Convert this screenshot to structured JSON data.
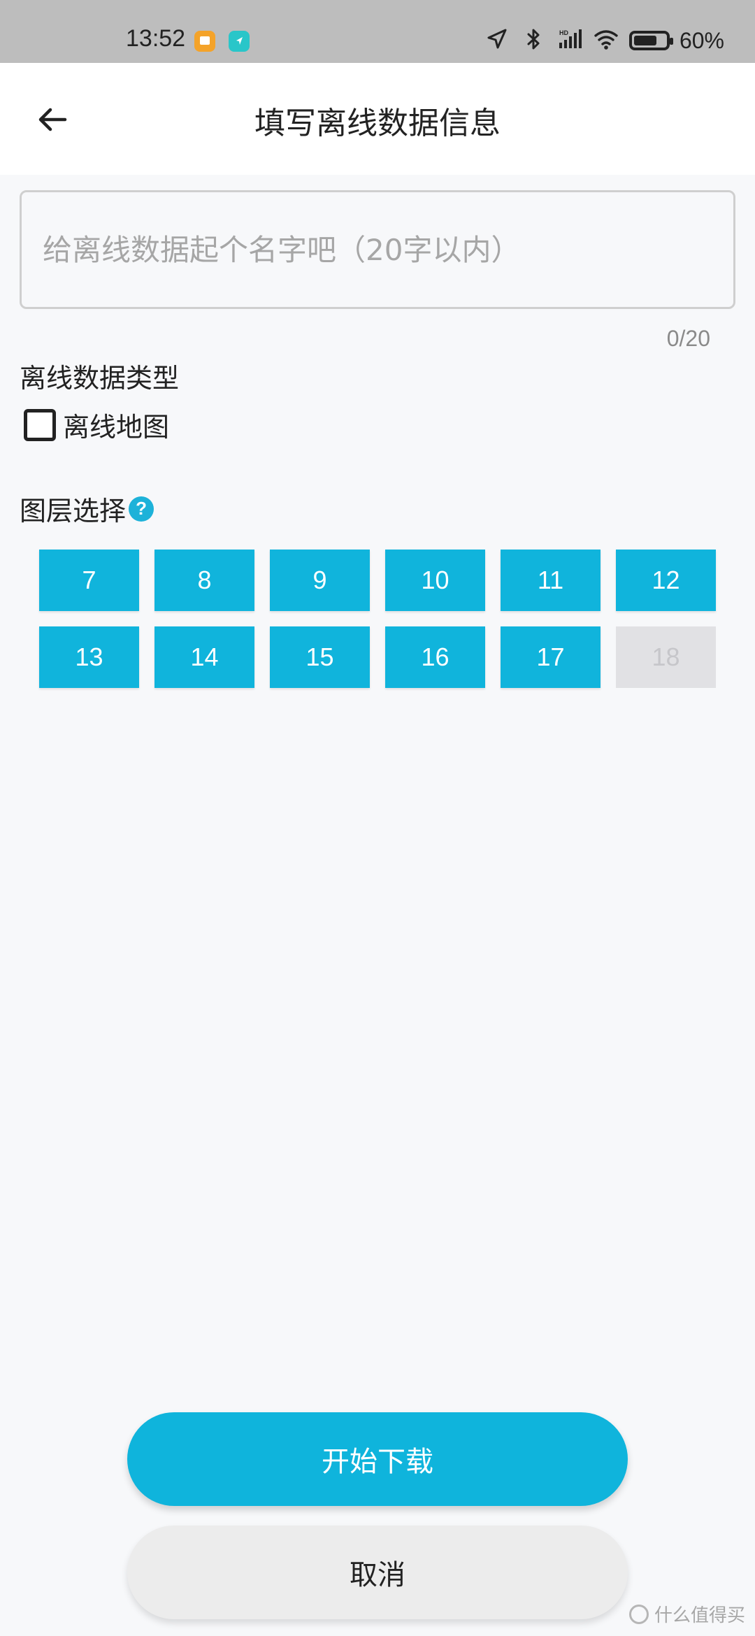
{
  "status_bar": {
    "time": "13:52",
    "battery_text": "60%",
    "icons": [
      "orange-app-icon",
      "teal-navigation-icon",
      "location-arrow-icon",
      "bluetooth-icon",
      "hd-signal-icon",
      "wifi-icon",
      "battery-icon"
    ]
  },
  "header": {
    "title": "填写离线数据信息"
  },
  "form": {
    "name_placeholder": "给离线数据起个名字吧（20字以内）",
    "name_value": "",
    "char_count": "0/20",
    "type_label": "离线数据类型",
    "offline_map_label": "离线地图",
    "layer_label": "图层选择",
    "layers": [
      {
        "label": "7",
        "enabled": true
      },
      {
        "label": "8",
        "enabled": true
      },
      {
        "label": "9",
        "enabled": true
      },
      {
        "label": "10",
        "enabled": true
      },
      {
        "label": "11",
        "enabled": true
      },
      {
        "label": "12",
        "enabled": true
      },
      {
        "label": "13",
        "enabled": true
      },
      {
        "label": "14",
        "enabled": true
      },
      {
        "label": "15",
        "enabled": true
      },
      {
        "label": "16",
        "enabled": true
      },
      {
        "label": "17",
        "enabled": true
      },
      {
        "label": "18",
        "enabled": false
      }
    ]
  },
  "actions": {
    "start_label": "开始下载",
    "cancel_label": "取消"
  },
  "watermark": {
    "text": "什么值得买"
  },
  "colors": {
    "accent": "#10b4dc",
    "disabled_layer": "#e1e1e4",
    "page_background": "#f7f8fa"
  }
}
